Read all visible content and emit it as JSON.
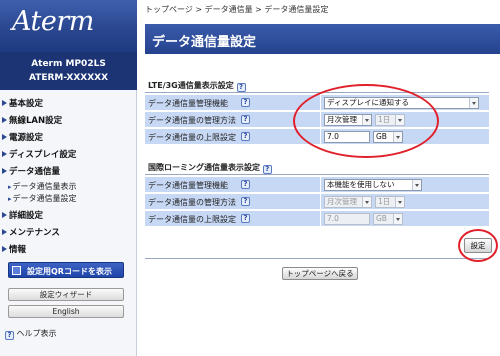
{
  "brand": {
    "logo": "Aterm",
    "model_name": "Aterm   MP02LS",
    "model_id": "ATERM-XXXXXX"
  },
  "nav": [
    {
      "label": "基本設定"
    },
    {
      "label": "無線LAN設定"
    },
    {
      "label": "電源設定"
    },
    {
      "label": "ディスプレイ設定"
    },
    {
      "label": "データ通信量"
    },
    {
      "label": "データ通信量表示",
      "sub": true
    },
    {
      "label": "データ通信量設定",
      "sub": true
    },
    {
      "label": "詳細設定"
    },
    {
      "label": "メンテナンス"
    },
    {
      "label": "情報"
    }
  ],
  "sidebar_buttons": {
    "qr_icon_text": "QR",
    "qr": "設定用QRコードを表示",
    "wizard": "設定ウィザード",
    "english": "English",
    "help": "ヘルプ表示"
  },
  "breadcrumb": "トップページ > データ通信量 > データ通信量設定",
  "page_title": "データ通信量設定",
  "help_icon": "?",
  "lte_section": {
    "title": "LTE/3G通信量表示設定",
    "rows": [
      {
        "label": "データ通信量管理機能",
        "value": "ディスプレイに通知する"
      },
      {
        "label": "データ通信量の管理方法",
        "value": "月次管理",
        "sub_value": "1日"
      },
      {
        "label": "データ通信量の上限設定",
        "value": "7.0",
        "unit": "GB"
      }
    ]
  },
  "roaming_section": {
    "title": "国際ローミング通信量表示設定",
    "rows": [
      {
        "label": "データ通信量管理機能",
        "value": "本機能を使用しない"
      },
      {
        "label": "データ通信量の管理方法",
        "value": "月次管理",
        "sub_value": "1日"
      },
      {
        "label": "データ通信量の上限設定",
        "value": "7.0",
        "unit": "GB"
      }
    ]
  },
  "buttons": {
    "apply": "設定",
    "back_top": "トップページへ戻る"
  },
  "colors": {
    "header_blue": "#24428e",
    "row_bg": "#c7d8f5",
    "highlight_red": "#e0202a"
  },
  "icons": {
    "nav_arrow": "triangle-right-icon",
    "help": "question-icon",
    "qr": "qr-code-icon",
    "select_caret": "chevron-down-icon"
  }
}
